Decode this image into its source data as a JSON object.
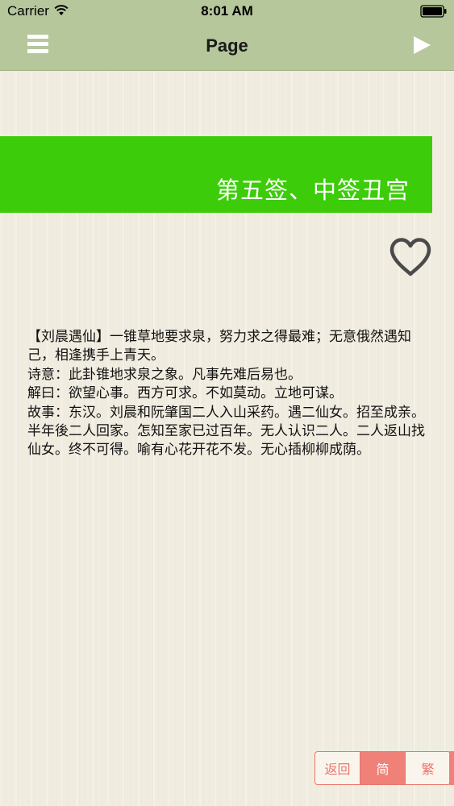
{
  "status_bar": {
    "carrier": "Carrier",
    "time": "8:01 AM"
  },
  "nav": {
    "title": "Page",
    "menu_icon": "hamburger-menu-icon",
    "play_icon": "play-triangle-icon"
  },
  "heading": {
    "text": "第五签、中签丑宫"
  },
  "favorite_icon": "heart-outline-icon",
  "content": {
    "text": "【刘晨遇仙】一锥草地要求泉，努力求之得最难；无意俄然遇知己，相逢携手上青天。\n诗意：此卦锥地求泉之象。凡事先难后易也。\n解曰：欲望心事。西方可求。不如莫动。立地可谋。\n故事：东汉。刘晨和阮肇国二人入山采药。遇二仙女。招至成亲。半年後二人回家。怎知至家已过百年。无人认识二人。二人返山找仙女。终不可得。喻有心花开花不发。无心插柳柳成荫。"
  },
  "segments": {
    "back": "返回",
    "simplified": "简",
    "traditional": "繁",
    "selected": "简"
  },
  "colors": {
    "nav_bar": "#b6c79c",
    "heading_band": "#3ccc0a",
    "segment_accent": "#ef8179",
    "background": "#f1ece0"
  }
}
